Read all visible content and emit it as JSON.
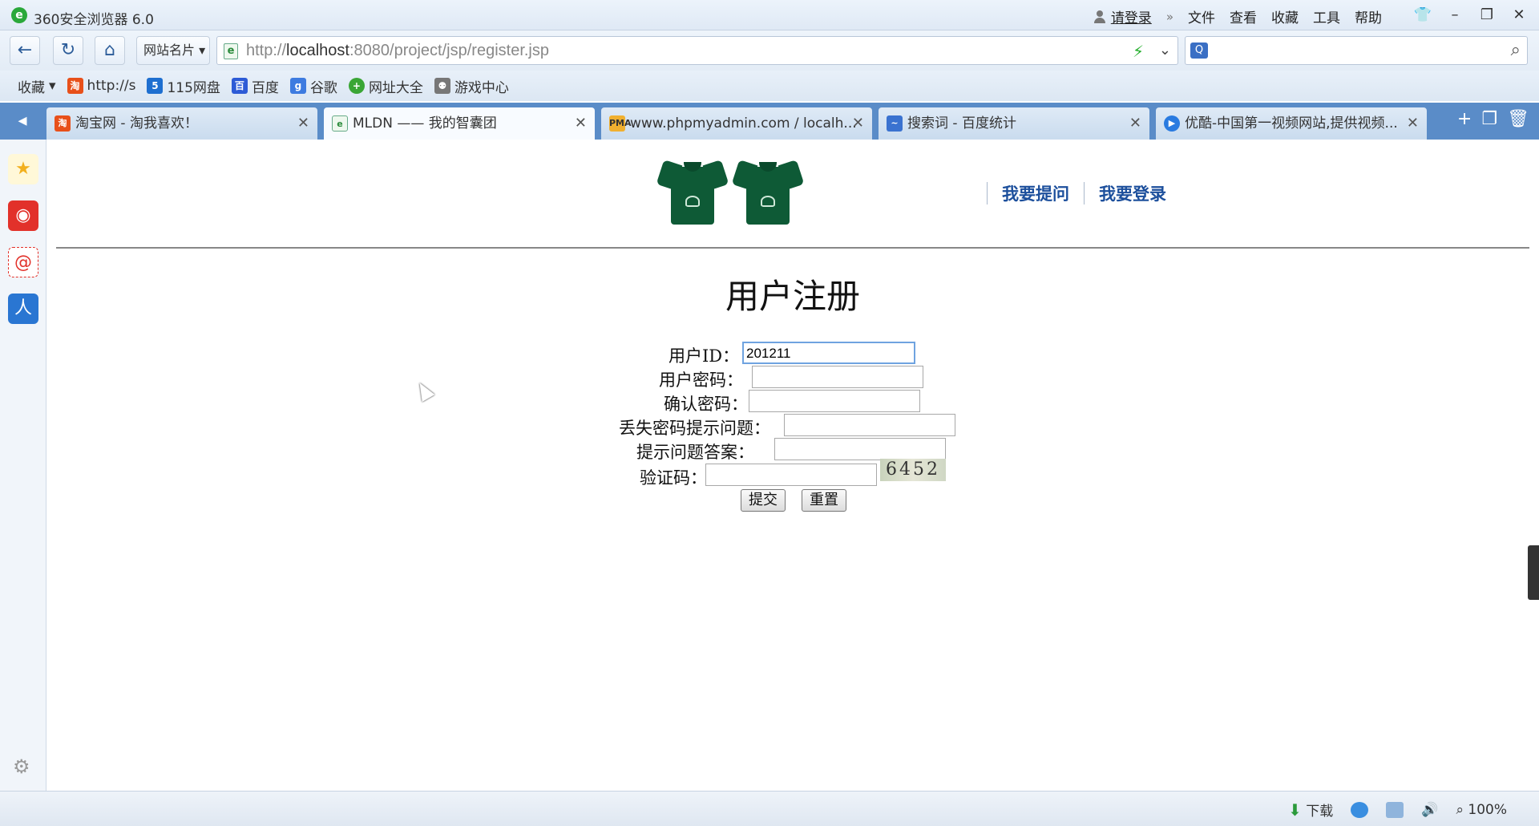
{
  "window": {
    "title": "360安全浏览器 6.0",
    "menus": {
      "login": "请登录",
      "file": "文件",
      "view": "查看",
      "favorites": "收藏",
      "tools": "工具",
      "help": "帮助"
    }
  },
  "navbar": {
    "site_card": "网站名片",
    "url_prefix": "http://",
    "url_host": "localhost",
    "url_rest": ":8080/project/jsp/register.jsp"
  },
  "favorites_bar": {
    "items": [
      {
        "label": "收藏",
        "icon": "star-icon"
      },
      {
        "label": "http://s",
        "icon": "taobao-icon"
      },
      {
        "label": "115网盘",
        "icon": "115-icon"
      },
      {
        "label": "百度",
        "icon": "baidu-paw-icon"
      },
      {
        "label": "谷歌",
        "icon": "google-icon"
      },
      {
        "label": "网址大全",
        "icon": "sites-icon"
      },
      {
        "label": "游戏中心",
        "icon": "gamepad-icon"
      }
    ]
  },
  "tabs": [
    {
      "label": "淘宝网 - 淘我喜欢！",
      "active": false
    },
    {
      "label": "MLDN —— 我的智囊团",
      "active": true
    },
    {
      "label": "www.phpmyadmin.com / localh...",
      "active": false
    },
    {
      "label": "搜索词 - 百度统计",
      "active": false
    },
    {
      "label": "优酷-中国第一视频网站,提供视频...",
      "active": false
    }
  ],
  "page": {
    "links": {
      "ask": "我要提问",
      "login": "我要登录"
    },
    "title": "用户注册",
    "form": {
      "user_id_label": "用户ID：",
      "user_id_value": "201211",
      "password_label": "用户密码：",
      "confirm_label": "确认密码：",
      "question_label": "丢失密码提示问题：",
      "answer_label": "提示问题答案：",
      "captcha_label": "验证码：",
      "captcha_value": "6452",
      "submit_label": "提交",
      "reset_label": "重置"
    }
  },
  "statusbar": {
    "download": "下载",
    "zoom": "100%"
  },
  "colors": {
    "tabbar": "#5a8cc8",
    "link": "#1c4f9c",
    "shirt": "#0e5a36"
  }
}
